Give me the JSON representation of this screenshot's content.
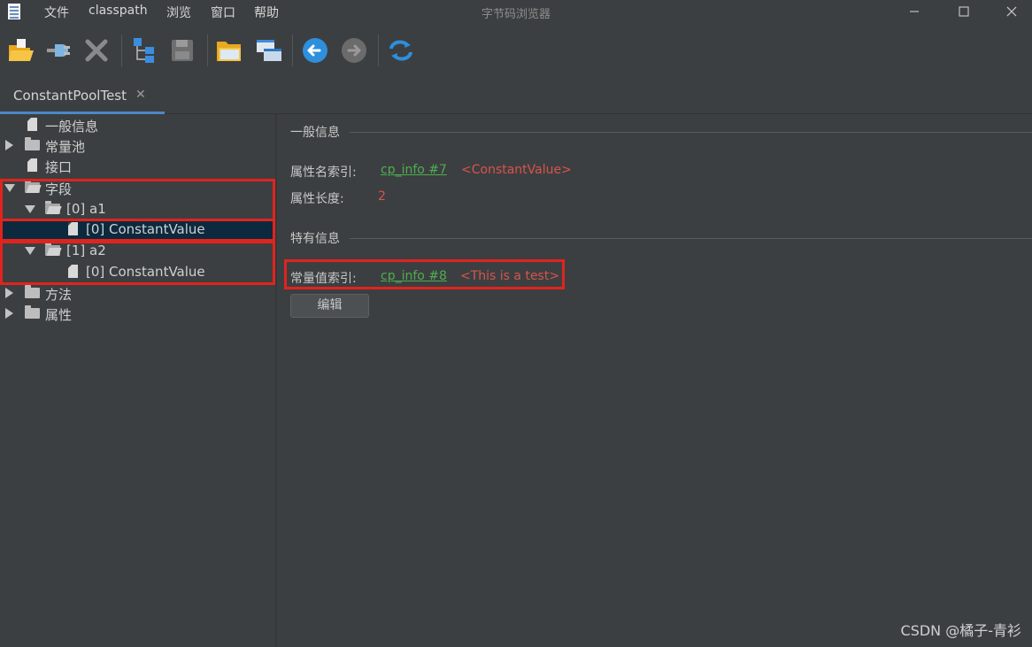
{
  "window": {
    "title": "字节码浏览器",
    "menu": [
      "文件",
      "classpath",
      "浏览",
      "窗口",
      "帮助"
    ]
  },
  "toolbar": {
    "icons": [
      "open-folder-icon",
      "plug-icon",
      "close-x-icon",
      "tree-structure-icon",
      "save-disk-icon",
      "folder-icon",
      "window-file-icon",
      "back-arrow-icon",
      "forward-arrow-icon",
      "refresh-icon"
    ]
  },
  "tabs": [
    {
      "label": "ConstantPoolTest",
      "close": "✕"
    }
  ],
  "tree": {
    "general": "一般信息",
    "constant_pool": "常量池",
    "interfaces": "接口",
    "fields": "字段",
    "field_a1": "[0] a1",
    "field_a1_attr": "[0] ConstantValue",
    "field_a2": "[1] a2",
    "field_a2_attr": "[0] ConstantValue",
    "methods": "方法",
    "attributes": "属性"
  },
  "detail": {
    "general_section": "一般信息",
    "attr_name_index_label": "属性名索引:",
    "attr_name_index_link": "cp_info #7",
    "attr_name_index_value": "<ConstantValue>",
    "attr_length_label": "属性长度:",
    "attr_length_value": "2",
    "specific_section": "特有信息",
    "const_value_index_label": "常量值索引:",
    "const_value_index_link": "cp_info #8",
    "const_value_index_value": "<This is a test>",
    "edit_button": "编辑"
  },
  "watermark": "CSDN @橘子-青衫",
  "colors": {
    "accent": "#4a88c7",
    "link": "#4eae4e",
    "value": "#d9534a",
    "highlight": "#e0241d",
    "selection": "#0d293e"
  }
}
